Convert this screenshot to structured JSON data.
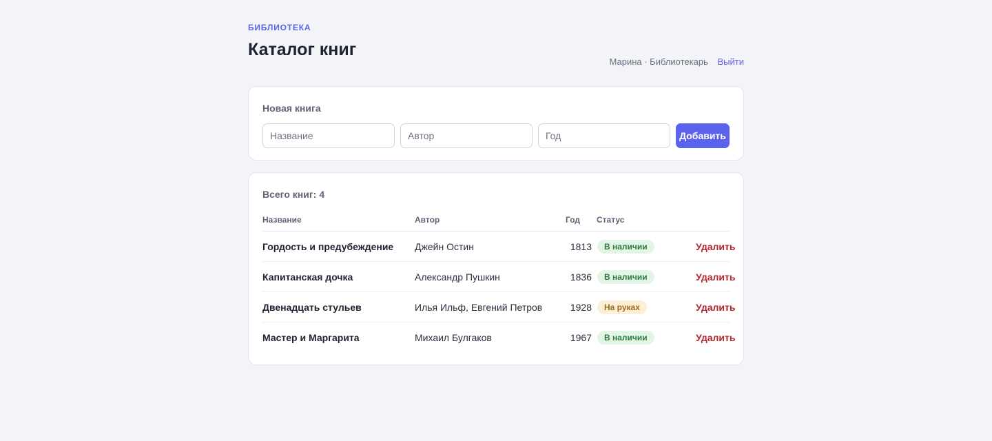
{
  "header": {
    "eyebrow": "БИБЛИОТЕКА",
    "title": "Каталог книг",
    "user": "Марина · Библиотекарь",
    "logout_label": "Выйти"
  },
  "add_form": {
    "label": "Новая книга",
    "title_placeholder": "Название",
    "author_placeholder": "Автор",
    "year_placeholder": "Год",
    "submit_label": "Добавить"
  },
  "catalog": {
    "count_label": "Всего книг:",
    "count": "4",
    "columns": {
      "title": "Название",
      "author": "Автор",
      "year": "Год",
      "status": "Статус"
    },
    "rows": [
      {
        "title": "Гордость и предубеждение",
        "author": "Джейн Остин",
        "year": "1813",
        "status": "В наличии",
        "status_kind": "available",
        "action": "Удалить"
      },
      {
        "title": "Капитанская дочка",
        "author": "Александр Пушкин",
        "year": "1836",
        "status": "В наличии",
        "status_kind": "available",
        "action": "Удалить"
      },
      {
        "title": "Двенадцать стульев",
        "author": "Илья Ильф, Евгений Петров",
        "year": "1928",
        "status": "На руках",
        "status_kind": "borrowed",
        "action": "Удалить"
      },
      {
        "title": "Мастер и Маргарита",
        "author": "Михаил Булгаков",
        "year": "1967",
        "status": "В наличии",
        "status_kind": "available",
        "action": "Удалить"
      }
    ]
  },
  "colors": {
    "accent": "#5b63ee",
    "danger": "#b3262a",
    "available_bg": "#e3f5e7",
    "borrowed_bg": "#fcefd6"
  }
}
